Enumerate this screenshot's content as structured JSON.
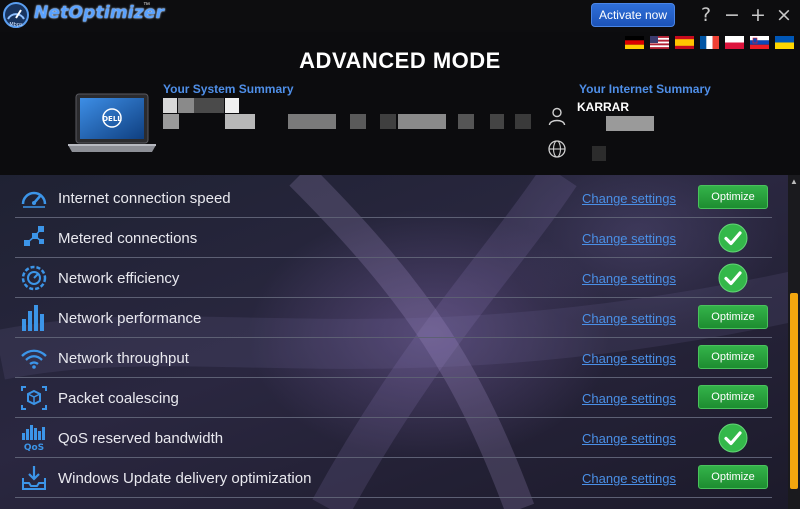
{
  "app": {
    "name": "NetOptimizer",
    "trademark": "™",
    "logo_text": "Mbps"
  },
  "titlebar": {
    "activate_label": "Activate now",
    "help": "?",
    "minimize": "−",
    "maximize": "+",
    "close": "×"
  },
  "languages": [
    "German",
    "English",
    "Spanish",
    "French",
    "Polish",
    "Slovenian",
    "Ukrainian"
  ],
  "header": {
    "title": "ADVANCED MODE",
    "system_summary_label": "Your System Summary",
    "internet_summary_label": "Your Internet Summary",
    "username": "KARRAR",
    "laptop_brand": "DELL"
  },
  "rows": [
    {
      "label": "Internet connection speed",
      "icon": "speedometer-icon",
      "link": "Change settings",
      "status": "optimize",
      "button": "Optimize"
    },
    {
      "label": "Metered connections",
      "icon": "metered-connections-icon",
      "link": "Change settings",
      "status": "ok",
      "button": ""
    },
    {
      "label": "Network efficiency",
      "icon": "efficiency-gauge-icon",
      "link": "Change settings",
      "status": "ok",
      "button": ""
    },
    {
      "label": "Network performance",
      "icon": "bar-chart-icon",
      "link": "Change settings",
      "status": "optimize",
      "button": "Optimize"
    },
    {
      "label": "Network throughput",
      "icon": "wifi-icon",
      "link": "Change settings",
      "status": "optimize",
      "button": "Optimize"
    },
    {
      "label": "Packet coalescing",
      "icon": "packet-icon",
      "link": "Change settings",
      "status": "optimize",
      "button": "Optimize"
    },
    {
      "label": "QoS reserved bandwidth",
      "icon": "qos-icon",
      "link": "Change settings",
      "status": "ok",
      "button": ""
    },
    {
      "label": "Windows Update delivery optimization",
      "icon": "download-tray-icon",
      "link": "Change settings",
      "status": "optimize",
      "button": "Optimize"
    }
  ],
  "colors": {
    "accent_blue": "#4f8fe8",
    "optimize_green": "#2aa33f",
    "scroll_thumb": "#f2a60f"
  }
}
